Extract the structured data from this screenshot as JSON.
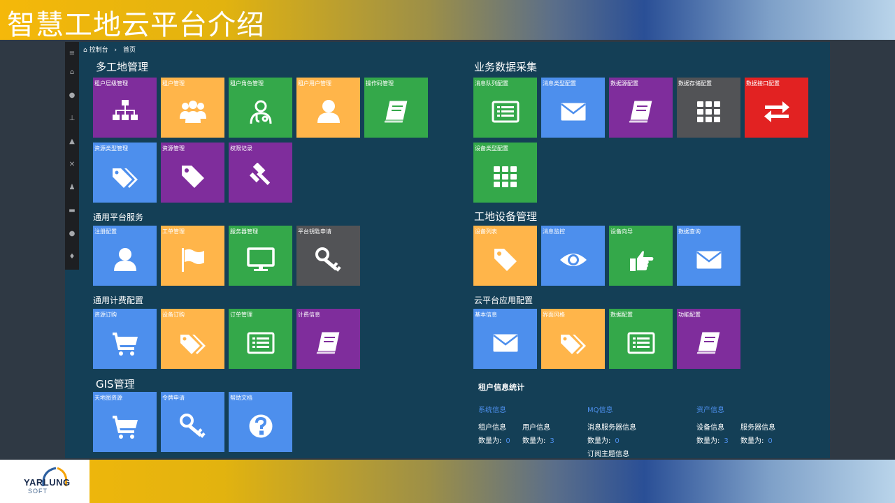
{
  "header": {
    "title": "智慧工地云平台介绍"
  },
  "logo": {
    "text": "YARLUNG",
    "sub": "SOFT"
  },
  "breadcrumb": {
    "home": "控制台",
    "current": "首页"
  },
  "sections": {
    "multi_site": "多工地管理",
    "data_collection": "业务数据采集",
    "platform_services": "通用平台服务",
    "site_devices": "工地设备管理",
    "billing": "通用计费配置",
    "cloud_app": "云平台应用配置",
    "gis": "GIS管理"
  },
  "tiles": {
    "t1": "租户层级管理",
    "t2": "租户管理",
    "t3": "租户角色管理",
    "t4": "租户用户管理",
    "t5": "操作码管理",
    "t6": "资源类型管理",
    "t7": "资源管理",
    "t8": "权限记录",
    "t9": "注册配置",
    "t10": "工单管理",
    "t11": "服务器管理",
    "t12": "平台钥匙申请",
    "t13": "资源订购",
    "t14": "设备订购",
    "t15": "订单管理",
    "t16": "计费信息",
    "t17": "天地图资源",
    "t18": "令牌申请",
    "t19": "帮助文档",
    "r1": "消息队列配置",
    "r2": "消息类型配置",
    "r3": "数据源配置",
    "r4": "数据存储配置",
    "r5": "数据接口配置",
    "r6": "设备类型配置",
    "r7": "设备列表",
    "r8": "消息监控",
    "r9": "设备向导",
    "r10": "数据查询",
    "r11": "基本信息",
    "r12": "界面风格",
    "r13": "数据配置",
    "r14": "功能配置"
  },
  "stats": {
    "title": "租户信息统计",
    "sys_head": "系统信息",
    "mq_head": "MQ信息",
    "asset_head": "资产信息",
    "tenant_info": "租户信息",
    "user_info": "用户信息",
    "msg_server_info": "消息服务器信息",
    "subscribe_info": "订阅主题信息",
    "device_info": "设备信息",
    "server_info": "服务器信息",
    "count_label": "数量为:",
    "tenant_count": "0",
    "user_count": "3",
    "msg_server_count": "0",
    "device_count": "3",
    "server_count": "0"
  },
  "colors": {
    "purple": "#7f2d9c",
    "orange": "#ffb54a",
    "green": "#34a84a",
    "blue": "#4d8fed",
    "gray": "#525356",
    "red": "#e22222",
    "screen_bg": "#143f56"
  }
}
